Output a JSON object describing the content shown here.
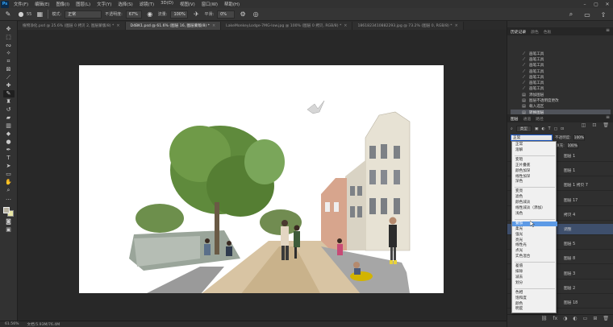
{
  "menubar": {
    "logo": "Ps",
    "items": [
      "文件(F)",
      "编辑(E)",
      "图像(I)",
      "图层(L)",
      "文字(Y)",
      "选择(S)",
      "滤镜(T)",
      "3D(D)",
      "视图(V)",
      "窗口(W)",
      "帮助(H)"
    ]
  },
  "options": {
    "brush_size": "55",
    "mode_label": "模式:",
    "mode_value": "正常",
    "opacity_label": "不透明度:",
    "opacity_value": "67%",
    "flow_label": "流量:",
    "flow_value": "100%",
    "smoothing_label": "平滑:",
    "smoothing_value": "0%"
  },
  "tabs": [
    {
      "label": "植物净化.psd @ 25.6% (图层 0 拷贝 2, 图层蒙版/8) *",
      "active": false
    },
    {
      "label": "D4BK1.psd @ 61.6% (图层 16, 图层蒙版/8) *",
      "active": true
    },
    {
      "label": "LakeMonkeyLodge-7MG-low.jpg @ 100% (图层 0 拷贝, RGB/8) *",
      "active": false
    },
    {
      "label": "1861823410882293.jpg @ 73.2% (图层 0, RGB/8) *",
      "active": false
    }
  ],
  "status": {
    "zoom": "61.56%",
    "doc": "文档:5.93M/76.4M"
  },
  "history_panel": {
    "tabs": [
      "历史记录",
      "颜色",
      "色板"
    ],
    "items": [
      {
        "label": "画笔工具",
        "icon": "brush-icon"
      },
      {
        "label": "画笔工具",
        "icon": "brush-icon"
      },
      {
        "label": "画笔工具",
        "icon": "brush-icon"
      },
      {
        "label": "画笔工具",
        "icon": "brush-icon"
      },
      {
        "label": "画笔工具",
        "icon": "brush-icon"
      },
      {
        "label": "画笔工具",
        "icon": "brush-icon"
      },
      {
        "label": "画笔工具",
        "icon": "brush-icon"
      },
      {
        "label": "添加图层",
        "icon": "layer-icon"
      },
      {
        "label": "图层不透明度更改",
        "icon": "layer-icon"
      },
      {
        "label": "载入选区",
        "icon": "layer-icon"
      },
      {
        "label": "转换图层",
        "icon": "layer-icon"
      }
    ],
    "selected_index": 10
  },
  "layers_panel": {
    "tabs": [
      "图层",
      "通道",
      "路径"
    ],
    "kind_label": "类型",
    "blend_mode": "正常",
    "opacity_label": "不透明度:",
    "opacity_value": "100%",
    "fill_label": "填充:",
    "fill_value": "100%",
    "layer_rows": [
      {
        "label": "图层 1",
        "selected": false
      },
      {
        "label": "图层 1",
        "selected": false
      },
      {
        "label": "图层 1 拷贝 7",
        "selected": false
      },
      {
        "label": "图层 17",
        "selected": false
      },
      {
        "label": "拷贝 4",
        "selected": false
      },
      {
        "label": "调整",
        "selected": true
      },
      {
        "label": "图层 5",
        "selected": false
      },
      {
        "label": "图层 8",
        "selected": false
      },
      {
        "label": "图层 3",
        "selected": false
      },
      {
        "label": "图层 2",
        "selected": false
      },
      {
        "label": "图层 18",
        "selected": false
      }
    ]
  },
  "blend_dropdown": {
    "groups": [
      [
        "正常",
        "溶解"
      ],
      [
        "变暗",
        "正片叠底",
        "颜色加深",
        "线性加深",
        "深色"
      ],
      [
        "变亮",
        "滤色",
        "颜色减淡",
        "线性减淡（添加）",
        "浅色"
      ],
      [
        "叠加",
        "柔光",
        "强光",
        "亮光",
        "线性光",
        "点光",
        "实色混合"
      ],
      [
        "差值",
        "排除",
        "减去",
        "划分"
      ],
      [
        "色相",
        "饱和度",
        "颜色",
        "明度"
      ]
    ],
    "highlighted": "叠加"
  },
  "colors": {
    "foreground": "#b8b3a2",
    "background": "#e8e6a6",
    "accent": "#5c9ae6"
  }
}
